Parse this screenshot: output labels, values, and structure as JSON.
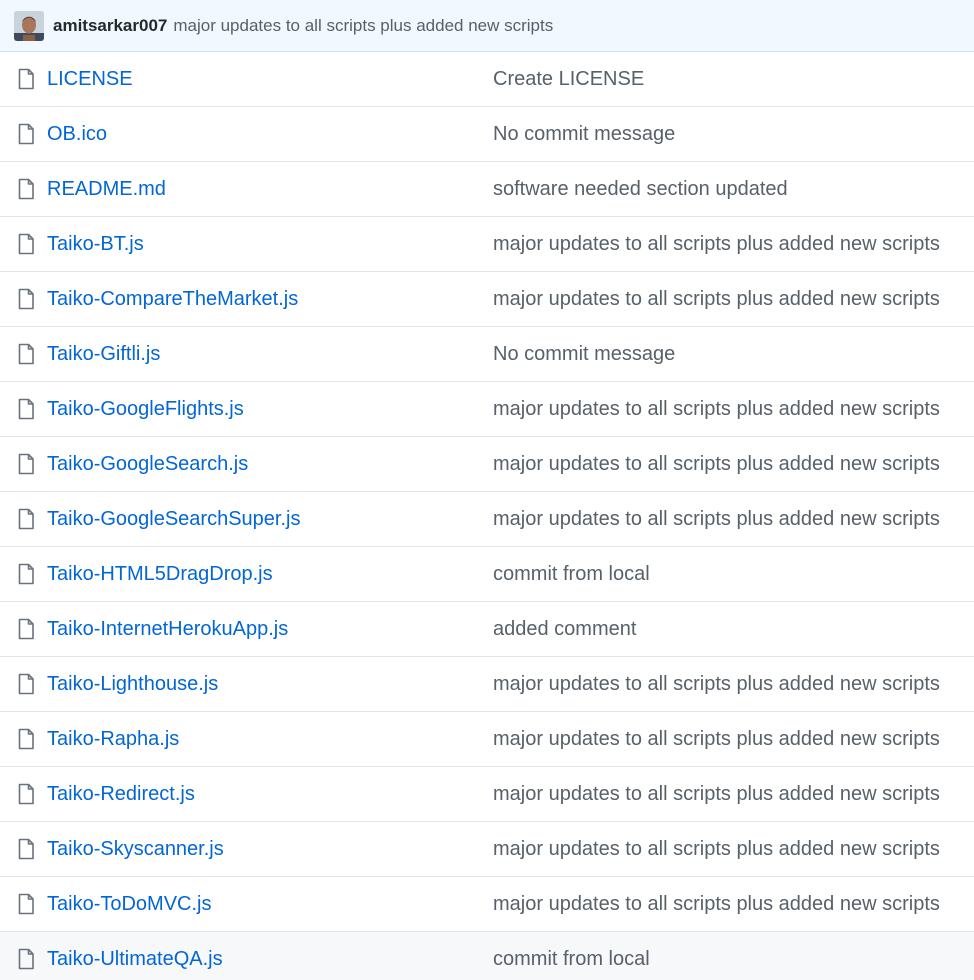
{
  "latest_commit": {
    "author": "amitsarkar007",
    "message": "major updates to all scripts plus added new scripts"
  },
  "files": [
    {
      "name": "LICENSE",
      "commit": "Create LICENSE",
      "icon": "file-icon"
    },
    {
      "name": "OB.ico",
      "commit": "No commit message",
      "icon": "file-icon"
    },
    {
      "name": "README.md",
      "commit": "software needed section updated",
      "icon": "file-icon"
    },
    {
      "name": "Taiko-BT.js",
      "commit": "major updates to all scripts plus added new scripts",
      "icon": "file-icon"
    },
    {
      "name": "Taiko-CompareTheMarket.js",
      "commit": "major updates to all scripts plus added new scripts",
      "icon": "file-icon"
    },
    {
      "name": "Taiko-Giftli.js",
      "commit": "No commit message",
      "icon": "file-icon"
    },
    {
      "name": "Taiko-GoogleFlights.js",
      "commit": "major updates to all scripts plus added new scripts",
      "icon": "file-icon"
    },
    {
      "name": "Taiko-GoogleSearch.js",
      "commit": "major updates to all scripts plus added new scripts",
      "icon": "file-icon"
    },
    {
      "name": "Taiko-GoogleSearchSuper.js",
      "commit": "major updates to all scripts plus added new scripts",
      "icon": "file-icon"
    },
    {
      "name": "Taiko-HTML5DragDrop.js",
      "commit": "commit from local",
      "icon": "file-icon"
    },
    {
      "name": "Taiko-InternetHerokuApp.js",
      "commit": "added comment",
      "icon": "file-icon"
    },
    {
      "name": "Taiko-Lighthouse.js",
      "commit": "major updates to all scripts plus added new scripts",
      "icon": "file-icon"
    },
    {
      "name": "Taiko-Rapha.js",
      "commit": "major updates to all scripts plus added new scripts",
      "icon": "file-icon"
    },
    {
      "name": "Taiko-Redirect.js",
      "commit": "major updates to all scripts plus added new scripts",
      "icon": "file-icon"
    },
    {
      "name": "Taiko-Skyscanner.js",
      "commit": "major updates to all scripts plus added new scripts",
      "icon": "file-icon"
    },
    {
      "name": "Taiko-ToDoMVC.js",
      "commit": "major updates to all scripts plus added new scripts",
      "icon": "file-icon"
    },
    {
      "name": "Taiko-UltimateQA.js",
      "commit": "commit from local",
      "icon": "file-icon"
    }
  ],
  "colors": {
    "link": "#0366d6",
    "muted": "#586069",
    "header_bg": "#f1f8ff",
    "hover_row_bg": "#f6f8fa"
  }
}
